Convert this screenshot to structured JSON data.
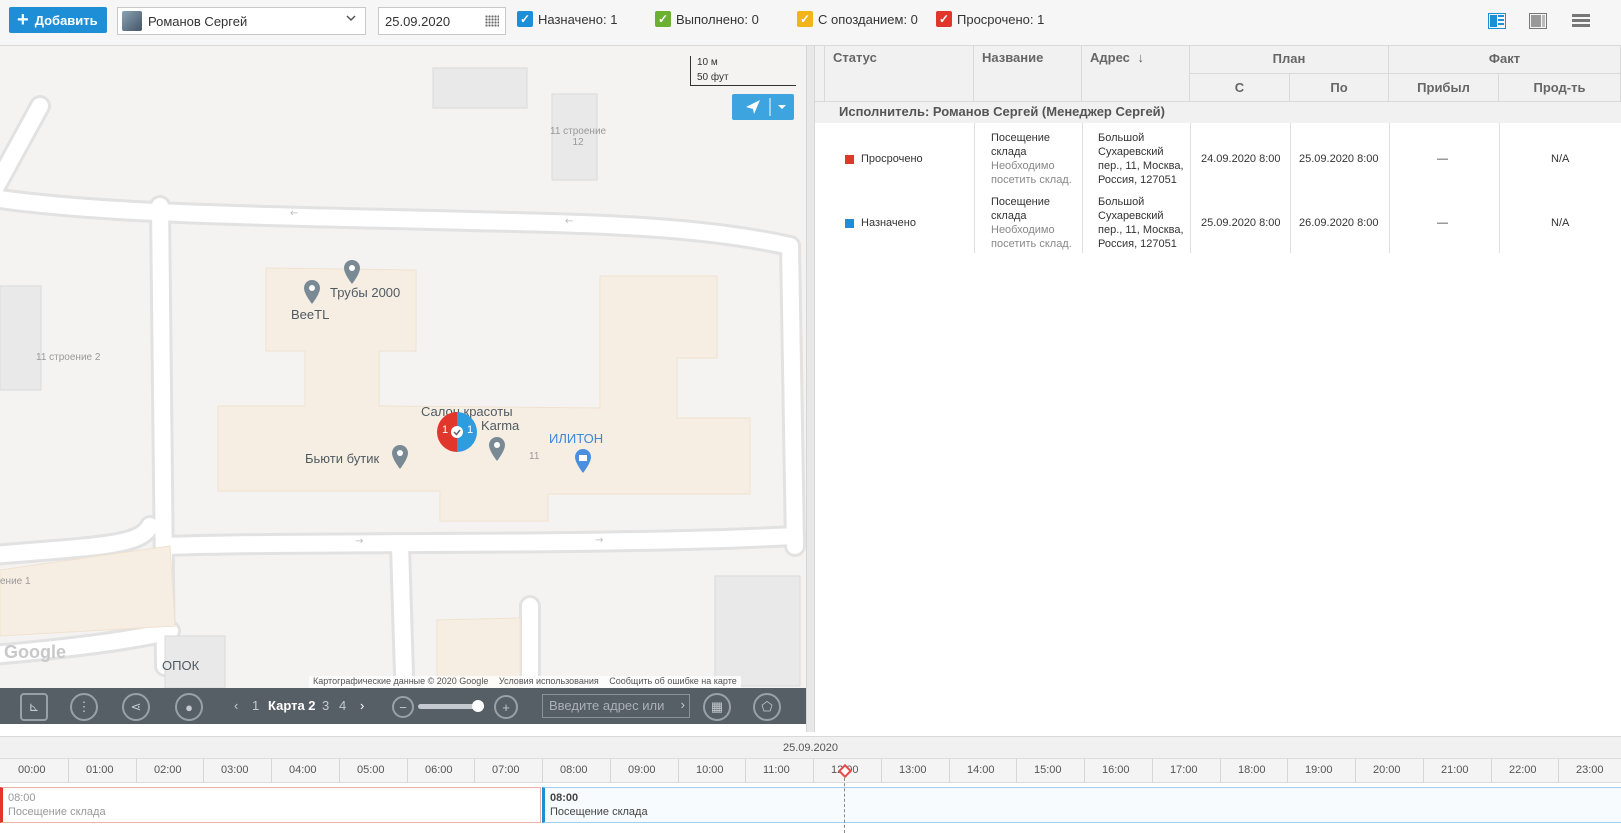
{
  "toolbar": {
    "add_label": "Добавить",
    "user": "Романов Сергей",
    "date": "25.09.2020",
    "filters": [
      {
        "label": "Назначено: 1",
        "color": "#1e8fd6"
      },
      {
        "label": "Выполнено: 0",
        "color": "#6bb02f"
      },
      {
        "label": "С опозданием: 0",
        "color": "#f3b41a"
      },
      {
        "label": "Просрочено: 1",
        "color": "#e0362c"
      }
    ]
  },
  "map": {
    "scale_m": "10 м",
    "scale_ft": "50 фут",
    "labels": {
      "building_11_12": "11 строение\n12",
      "building_11_2": "11 строение 2",
      "building_1": "ение 1",
      "truby": "Трубы 2000",
      "beetl": "BeeTL",
      "salon": "Салон красоты",
      "karma": "Karma",
      "iliton": "ИЛИТОН",
      "butik": "Бьюти бутик",
      "num_11": "11",
      "opok": "ОПОК"
    },
    "cluster": {
      "left": "1",
      "right": "1"
    },
    "footer": {
      "google": "Google",
      "data": "Картографические данные © 2020 Google",
      "terms": "Условия использования",
      "report": "Сообщить об ошибке на карте"
    },
    "bar": {
      "pages": [
        "1",
        "Карта 2",
        "3",
        "4"
      ],
      "search_placeholder": "Введите адрес или"
    }
  },
  "table": {
    "headers": {
      "status": "Статус",
      "name": "Название",
      "address": "Адрес",
      "plan": "План",
      "fact": "Факт",
      "plan_from": "С",
      "plan_to": "По",
      "arrived": "Прибыл",
      "duration": "Прод-ть"
    },
    "group": "Исполнитель: Романов Сергей (Менеджер Сергей)",
    "rows": [
      {
        "status": "Просрочено",
        "status_color": "#e0362c",
        "name": "Посещение склада",
        "desc": "Необходимо посетить склад.",
        "address": "Большой Сухаревский пер., 11, Москва, Россия, 127051",
        "from": "24.09.2020 8:00",
        "to": "25.09.2020 8:00",
        "arrived": "—",
        "duration": "N/A"
      },
      {
        "status": "Назначено",
        "status_color": "#1e8fd6",
        "name": "Посещение склада",
        "desc": "Необходимо посетить склад.",
        "address": "Большой Сухаревский пер., 11, Москва, Россия, 127051",
        "from": "25.09.2020 8:00",
        "to": "26.09.2020 8:00",
        "arrived": "—",
        "duration": "N/A"
      }
    ]
  },
  "timeline": {
    "date": "25.09.2020",
    "hours": [
      "00:00",
      "01:00",
      "02:00",
      "03:00",
      "04:00",
      "05:00",
      "06:00",
      "07:00",
      "08:00",
      "09:00",
      "10:00",
      "11:00",
      "12:00",
      "13:00",
      "14:00",
      "15:00",
      "16:00",
      "17:00",
      "18:00",
      "19:00",
      "20:00",
      "21:00",
      "22:00",
      "23:00"
    ],
    "tasks": [
      {
        "time": "08:00",
        "title": "Посещение склада",
        "color": "#e0362c"
      },
      {
        "time": "08:00",
        "title": "Посещение склада",
        "color": "#1e8fd6"
      }
    ]
  }
}
